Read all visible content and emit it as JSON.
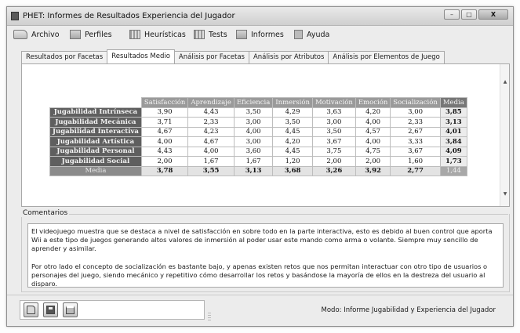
{
  "window": {
    "title": "PHET: Informes de Resultados Experiencia del Jugador",
    "controls": {
      "minimize": "–",
      "maximize": "□",
      "close": "X"
    }
  },
  "menu": [
    {
      "label": "Archivo",
      "icon": "folder-icon"
    },
    {
      "label": "Perfiles",
      "icon": "profiles-icon"
    },
    {
      "label": "Heurísticas",
      "icon": "heuristics-icon"
    },
    {
      "label": "Tests",
      "icon": "tests-icon"
    },
    {
      "label": "Informes",
      "icon": "reports-icon"
    },
    {
      "label": "Ayuda",
      "icon": "help-icon"
    }
  ],
  "tabs": [
    {
      "label": "Resultados por Facetas",
      "active": false
    },
    {
      "label": "Resultados Medio",
      "active": true
    },
    {
      "label": "Análisis por Facetas",
      "active": false
    },
    {
      "label": "Análisis por Atributos",
      "active": false
    },
    {
      "label": "Análisis por Elementos de Juego",
      "active": false
    }
  ],
  "table": {
    "columns": [
      "Satisfacción",
      "Aprendizaje",
      "Eficiencia",
      "Inmersión",
      "Motivación",
      "Emoción",
      "Socialización",
      "Media"
    ],
    "rows": [
      {
        "label": "Jugabilidad Intrínseca",
        "values": [
          "3,90",
          "4,43",
          "3,50",
          "4,29",
          "3,63",
          "4,20",
          "3,00"
        ],
        "media": "3,85"
      },
      {
        "label": "Jugabilidad Mecánica",
        "values": [
          "3,71",
          "2,33",
          "3,00",
          "3,50",
          "3,00",
          "4,00",
          "2,33"
        ],
        "media": "3,13"
      },
      {
        "label": "Jugabilidad Interactiva",
        "values": [
          "4,67",
          "4,23",
          "4,00",
          "4,45",
          "3,50",
          "4,57",
          "2,67"
        ],
        "media": "4,01"
      },
      {
        "label": "Jugabilidad Artística",
        "values": [
          "4,00",
          "4,67",
          "3,00",
          "4,20",
          "3,67",
          "4,00",
          "3,33"
        ],
        "media": "3,84"
      },
      {
        "label": "Jugabilidad Personal",
        "values": [
          "4,43",
          "4,00",
          "3,60",
          "4,45",
          "3,75",
          "4,75",
          "3,67"
        ],
        "media": "4,09"
      },
      {
        "label": "Jugabilidad Social",
        "values": [
          "2,00",
          "1,67",
          "1,67",
          "1,20",
          "2,00",
          "2,00",
          "1,60"
        ],
        "media": "1,73"
      }
    ],
    "media_row": {
      "label": "Media",
      "values": [
        "3,78",
        "3,55",
        "3,13",
        "3,68",
        "3,26",
        "3,92",
        "2,77"
      ],
      "media": "1,44"
    }
  },
  "comments": {
    "legend": "Comentarios",
    "paragraphs": [
      "El videojuego muestra que se destaca a nivel de satisfacción en sobre todo en la parte interactiva, esto es debido al buen control que aporta Wii a este tipo de juegos generando altos valores de inmersión al poder usar este mando como arma o volante. Siempre muy sencillo de aprender y asimilar.",
      "Por otro lado el concepto de socialización es bastante bajo, y apenas existen retos que nos permitan interactuar con otro tipo de usuarios o personajes del juego, siendo mecánico y repetitivo cómo desarrollar los retos y basándose la mayoría de ellos en la destreza del usuario al disparo."
    ]
  },
  "toolbar": [
    "open-icon",
    "save-icon",
    "print-icon"
  ],
  "status": "Modo: Informe Jugabilidad y Experiencia del Jugador"
}
